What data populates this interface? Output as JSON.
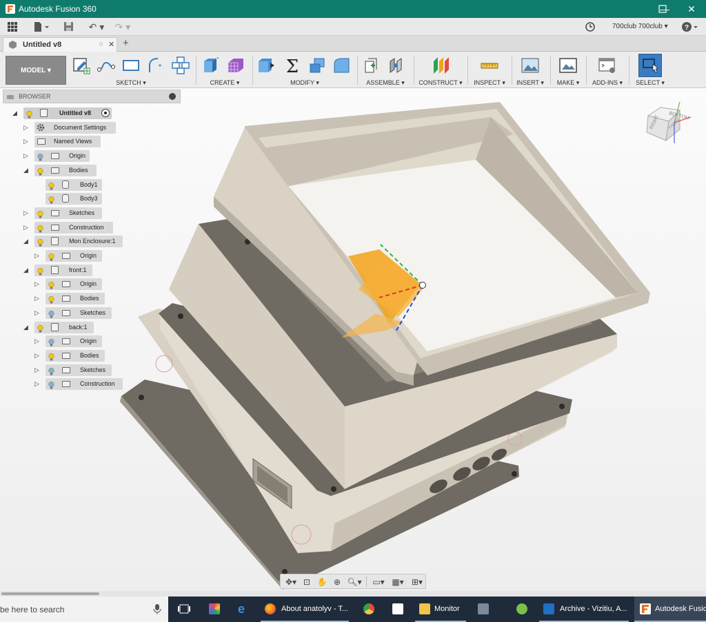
{
  "window": {
    "title": "Autodesk Fusion 360"
  },
  "qat": {
    "user_label": "700club 700club ▾"
  },
  "document": {
    "tab_label": "Untitled v8"
  },
  "ribbon": {
    "workspace_label": "MODEL ▾",
    "groups": [
      {
        "label": "SKETCH ▾"
      },
      {
        "label": "CREATE ▾"
      },
      {
        "label": "MODIFY ▾"
      },
      {
        "label": "ASSEMBLE ▾"
      },
      {
        "label": "CONSTRUCT ▾"
      },
      {
        "label": "INSPECT ▾"
      },
      {
        "label": "INSERT ▾"
      },
      {
        "label": "MAKE ▾"
      },
      {
        "label": "ADD-INS ▾"
      },
      {
        "label": "SELECT ▾"
      }
    ]
  },
  "browser": {
    "title": "BROWSER",
    "items": [
      {
        "label": "Untitled v8"
      },
      {
        "label": "Document Settings"
      },
      {
        "label": "Named Views"
      },
      {
        "label": "Origin"
      },
      {
        "label": "Bodies"
      },
      {
        "label": "Body1"
      },
      {
        "label": "Body3"
      },
      {
        "label": "Sketches"
      },
      {
        "label": "Construction"
      },
      {
        "label": "Mon Enclosure:1"
      },
      {
        "label": "Origin"
      },
      {
        "label": "front:1"
      },
      {
        "label": "Origin"
      },
      {
        "label": "Bodies"
      },
      {
        "label": "Sketches"
      },
      {
        "label": "back:1"
      },
      {
        "label": "Origin"
      },
      {
        "label": "Bodies"
      },
      {
        "label": "Sketches"
      },
      {
        "label": "Construction"
      }
    ]
  },
  "viewcube": {
    "face_top": "BOTTOM",
    "face_left": "RIGHT",
    "face_right": "FRONT"
  },
  "taskbar": {
    "search_text": "be here to search",
    "items": [
      {
        "label": "About anatolyv - T..."
      },
      {
        "label": "Monitor"
      },
      {
        "label": "Archive - Vizitiu, A..."
      },
      {
        "label": "Autodesk Fusion"
      }
    ]
  },
  "colors": {
    "titlebar": "#0f7b6c",
    "accent": "#3b7bbf",
    "plane": "#f2a21a",
    "body_face": "#d8d1c5",
    "body_dark": "#7a756c"
  }
}
